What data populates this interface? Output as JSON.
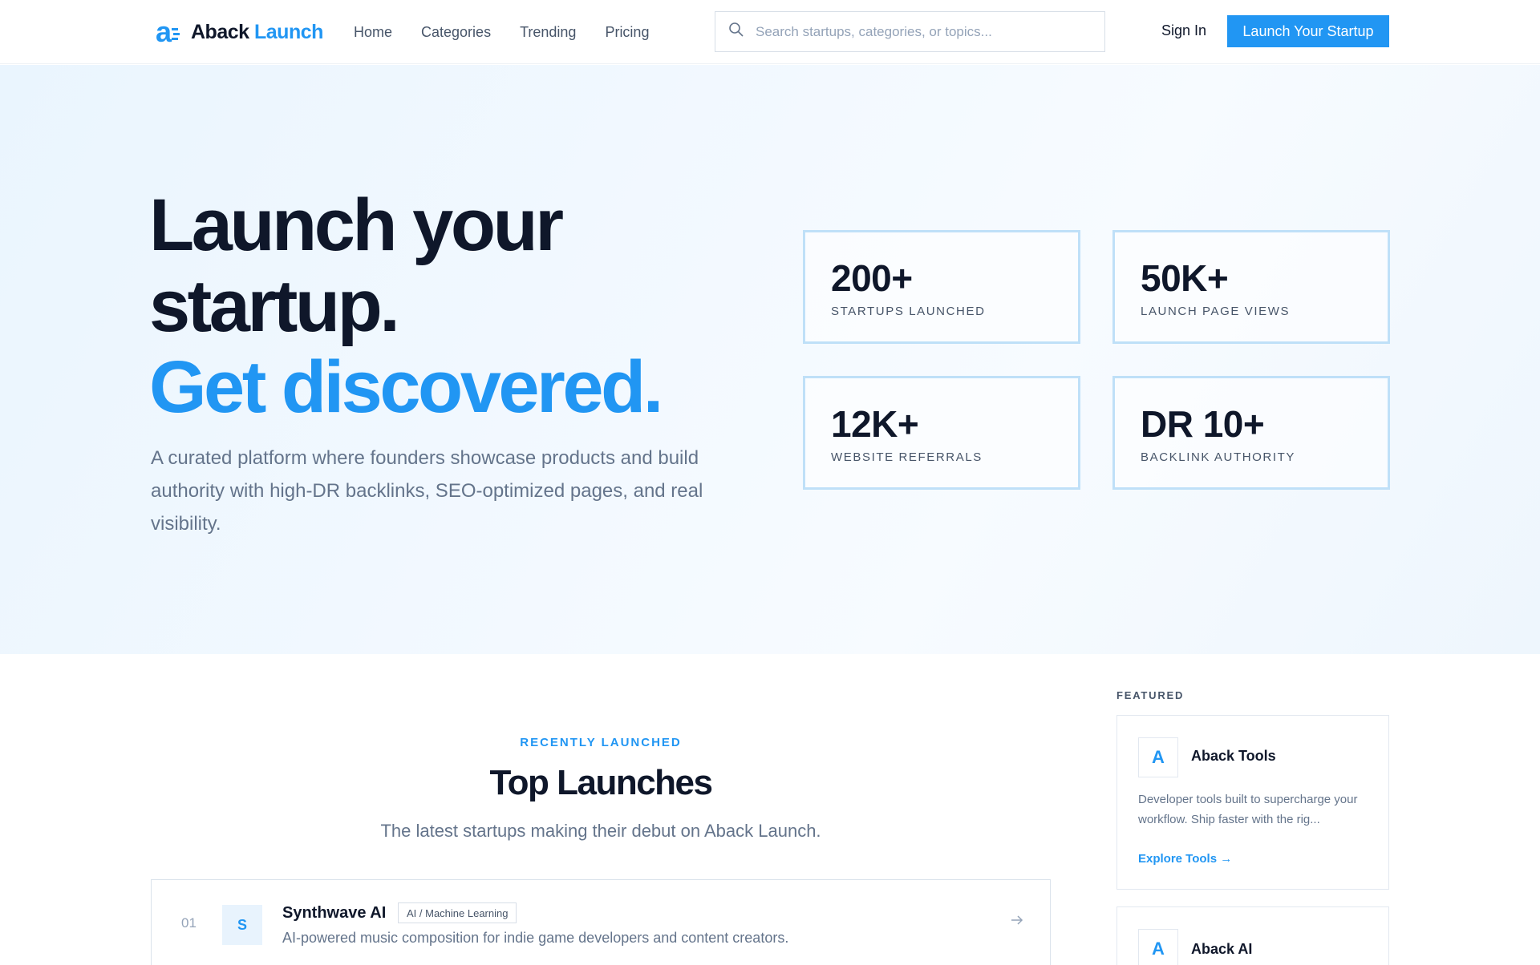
{
  "header": {
    "logo": {
      "brand_dark": "Aback",
      "brand_accent": "Launch"
    },
    "nav": [
      "Home",
      "Categories",
      "Trending",
      "Pricing"
    ],
    "search": {
      "placeholder": "Search startups, categories, or topics...",
      "value": ""
    },
    "sign_in": "Sign In",
    "cta": "Launch Your Startup"
  },
  "hero": {
    "title_line1": "Launch your",
    "title_line2": "startup.",
    "title_accent": "Get discovered.",
    "subtitle": "A curated platform where founders showcase products and build authority with high-DR backlinks, SEO-optimized pages, and real visibility.",
    "stats": [
      {
        "value": "200+",
        "label": "STARTUPS LAUNCHED"
      },
      {
        "value": "50K+",
        "label": "LAUNCH PAGE VIEWS"
      },
      {
        "value": "12K+",
        "label": "WEBSITE REFERRALS"
      },
      {
        "value": "DR 10+",
        "label": "BACKLINK AUTHORITY"
      }
    ]
  },
  "launches": {
    "eyebrow": "RECENTLY LAUNCHED",
    "title": "Top Launches",
    "subtitle": "The latest startups making their debut on Aback Launch.",
    "items": [
      {
        "rank": "01",
        "initial": "S",
        "name": "Synthwave AI",
        "tag": "AI / Machine Learning",
        "description": "AI-powered music composition for indie game developers and content creators."
      }
    ]
  },
  "featured": {
    "label": "FEATURED",
    "items": [
      {
        "initial": "A",
        "name": "Aback Tools",
        "description": "Developer tools built to supercharge your workflow. Ship faster with the rig...",
        "link": "Explore Tools →"
      },
      {
        "initial": "A",
        "name": "Aback AI"
      }
    ]
  },
  "colors": {
    "accent": "#2196f3",
    "text_dark": "#0f172a",
    "text_muted": "#64748b",
    "stat_border": "#bfe0f8"
  }
}
